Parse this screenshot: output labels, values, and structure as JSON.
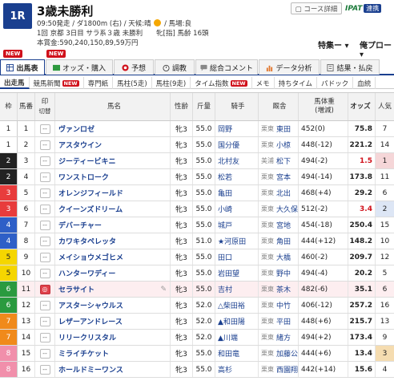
{
  "race": {
    "number": "1R",
    "title": "3歳未勝利",
    "info_line1_pre": "09:50発走 / ダ1800m (右) / 天候:晴",
    "info_line1_post": "/ 馬場:良",
    "info_line2": "1回 京都 3日目 サラ系３歳 未勝利　　牝[指] 馬齢 16頭",
    "info_line3": "本賞金:590,240,150,89,59万円"
  },
  "header_links": {
    "course": "▢ コース詳細",
    "ipat_logo": "IPAT",
    "ipat_link": "連携",
    "special": "特集ー ▾",
    "mypage": "俺プロー ▾"
  },
  "badges": {
    "new": "NEW"
  },
  "tabs": [
    {
      "label": "出馬表",
      "icon": "table-icon"
    },
    {
      "label": "オッズ・購入",
      "icon": "yen-icon"
    },
    {
      "label": "予想",
      "icon": "target-icon"
    },
    {
      "label": "調教",
      "icon": "stopwatch-icon"
    },
    {
      "label": "総合コメント",
      "icon": "comment-icon"
    },
    {
      "label": "データ分析",
      "icon": "chart-icon"
    },
    {
      "label": "結果・払戻",
      "icon": "result-icon"
    }
  ],
  "subtabs": [
    {
      "label": "出走馬"
    },
    {
      "label": "競馬新聞",
      "badge": "NEW"
    },
    {
      "label": "専門紙"
    },
    {
      "label": "馬柱(5走)"
    },
    {
      "label": "馬柱(9走)"
    },
    {
      "label": "タイム指数",
      "badge": "NEW"
    },
    {
      "label": "メモ"
    },
    {
      "label": "持ちタイム"
    },
    {
      "label": "パドック"
    },
    {
      "label": "血統"
    }
  ],
  "columns": {
    "waku": "枠",
    "uma": "馬番",
    "mark": "印",
    "mark_sub": "切替",
    "name": "馬名",
    "sex": "性齢",
    "weight": "斤量",
    "jockey": "騎手",
    "stable": "厩舎",
    "body": "馬体重",
    "body_sub": "(増減)",
    "odds": "オッズ",
    "pop": "人気"
  },
  "colors": {
    "waku": [
      "#ffffff",
      "#222222",
      "#e83c3c",
      "#2e5fc7",
      "#f5d600",
      "#2a9a3f",
      "#f08a1b",
      "#f18fab"
    ]
  },
  "horses": [
    {
      "waku": "1",
      "uma": "1",
      "name": "ヴァンロゼ",
      "sex": "牝3",
      "weight": "55.0",
      "jockey": "岡野",
      "stable_pre": "栗東",
      "stable": "東田",
      "body": "452(0)",
      "odds": "75.8",
      "pop": "7"
    },
    {
      "waku": "1",
      "uma": "2",
      "name": "アスタウイン",
      "sex": "牝3",
      "weight": "55.0",
      "jockey": "国分優",
      "stable_pre": "栗東",
      "stable": "小椋",
      "body": "448(-12)",
      "odds": "221.2",
      "pop": "14"
    },
    {
      "waku": "2",
      "uma": "3",
      "name": "ジーティービキニ",
      "sex": "牝3",
      "weight": "55.0",
      "jockey": "北村友",
      "stable_pre": "美浦",
      "stable": "松下",
      "body": "494(-2)",
      "odds": "1.5",
      "pop": "1"
    },
    {
      "waku": "2",
      "uma": "4",
      "name": "ワンストローク",
      "sex": "牝3",
      "weight": "55.0",
      "jockey": "松若",
      "stable_pre": "栗東",
      "stable": "宮本",
      "body": "494(-14)",
      "odds": "173.8",
      "pop": "11"
    },
    {
      "waku": "3",
      "uma": "5",
      "name": "オレンジフィールド",
      "sex": "牝3",
      "weight": "55.0",
      "jockey": "亀田",
      "stable_pre": "栗東",
      "stable": "北出",
      "body": "468(+4)",
      "odds": "29.2",
      "pop": "6"
    },
    {
      "waku": "3",
      "uma": "6",
      "name": "クイーンズドリーム",
      "sex": "牝3",
      "weight": "55.0",
      "jockey": "小崎",
      "stable_pre": "栗東",
      "stable": "大久保",
      "body": "512(-2)",
      "odds": "3.4",
      "pop": "2"
    },
    {
      "waku": "4",
      "uma": "7",
      "name": "デバーチャー",
      "sex": "牝3",
      "weight": "55.0",
      "jockey": "城戸",
      "stable_pre": "栗東",
      "stable": "宮地",
      "body": "454(-18)",
      "odds": "250.4",
      "pop": "15"
    },
    {
      "waku": "4",
      "uma": "8",
      "name": "カワキタペレッタ",
      "sex": "牝3",
      "weight": "51.0",
      "jockey": "★河原田",
      "stable_pre": "栗東",
      "stable": "角田",
      "body": "444(+12)",
      "odds": "148.2",
      "pop": "10"
    },
    {
      "waku": "5",
      "uma": "9",
      "name": "メイショウメゴヒメ",
      "sex": "牝3",
      "weight": "55.0",
      "jockey": "田口",
      "stable_pre": "栗東",
      "stable": "大橋",
      "body": "460(-2)",
      "odds": "209.7",
      "pop": "12"
    },
    {
      "waku": "5",
      "uma": "10",
      "name": "ハンターワディー",
      "sex": "牝3",
      "weight": "55.0",
      "jockey": "岩田望",
      "stable_pre": "栗東",
      "stable": "野中",
      "body": "494(-4)",
      "odds": "20.2",
      "pop": "5"
    },
    {
      "waku": "6",
      "uma": "11",
      "name": "セラサイト",
      "sex": "牝3",
      "weight": "55.0",
      "jockey": "吉村",
      "stable_pre": "栗東",
      "stable": "茶木",
      "body": "482(-6)",
      "odds": "35.1",
      "pop": "6",
      "selected": true
    },
    {
      "waku": "6",
      "uma": "12",
      "name": "アスターシャウルス",
      "sex": "牝3",
      "weight": "52.0",
      "jockey": "△柴田裕",
      "stable_pre": "栗東",
      "stable": "中竹",
      "body": "406(-12)",
      "odds": "257.2",
      "pop": "16"
    },
    {
      "waku": "7",
      "uma": "13",
      "name": "レザーアンドレース",
      "sex": "牝3",
      "weight": "52.0",
      "jockey": "▲和田陽",
      "stable_pre": "栗東",
      "stable": "平田",
      "body": "448(+6)",
      "odds": "215.7",
      "pop": "13"
    },
    {
      "waku": "7",
      "uma": "14",
      "name": "リリークリスタル",
      "sex": "牝3",
      "weight": "52.0",
      "jockey": "▲川端",
      "stable_pre": "栗東",
      "stable": "緒方",
      "body": "494(+2)",
      "odds": "173.4",
      "pop": "9"
    },
    {
      "waku": "8",
      "uma": "15",
      "name": "ミライチケット",
      "sex": "牝3",
      "weight": "55.0",
      "jockey": "和田竜",
      "stable_pre": "栗東",
      "stable": "加藤公",
      "body": "444(+6)",
      "odds": "13.4",
      "pop": "3"
    },
    {
      "waku": "8",
      "uma": "16",
      "name": "ホールドミーワンス",
      "sex": "牝3",
      "weight": "55.0",
      "jockey": "高杉",
      "stable_pre": "栗東",
      "stable": "西園翔",
      "body": "442(+14)",
      "odds": "15.6",
      "pop": "4"
    }
  ]
}
